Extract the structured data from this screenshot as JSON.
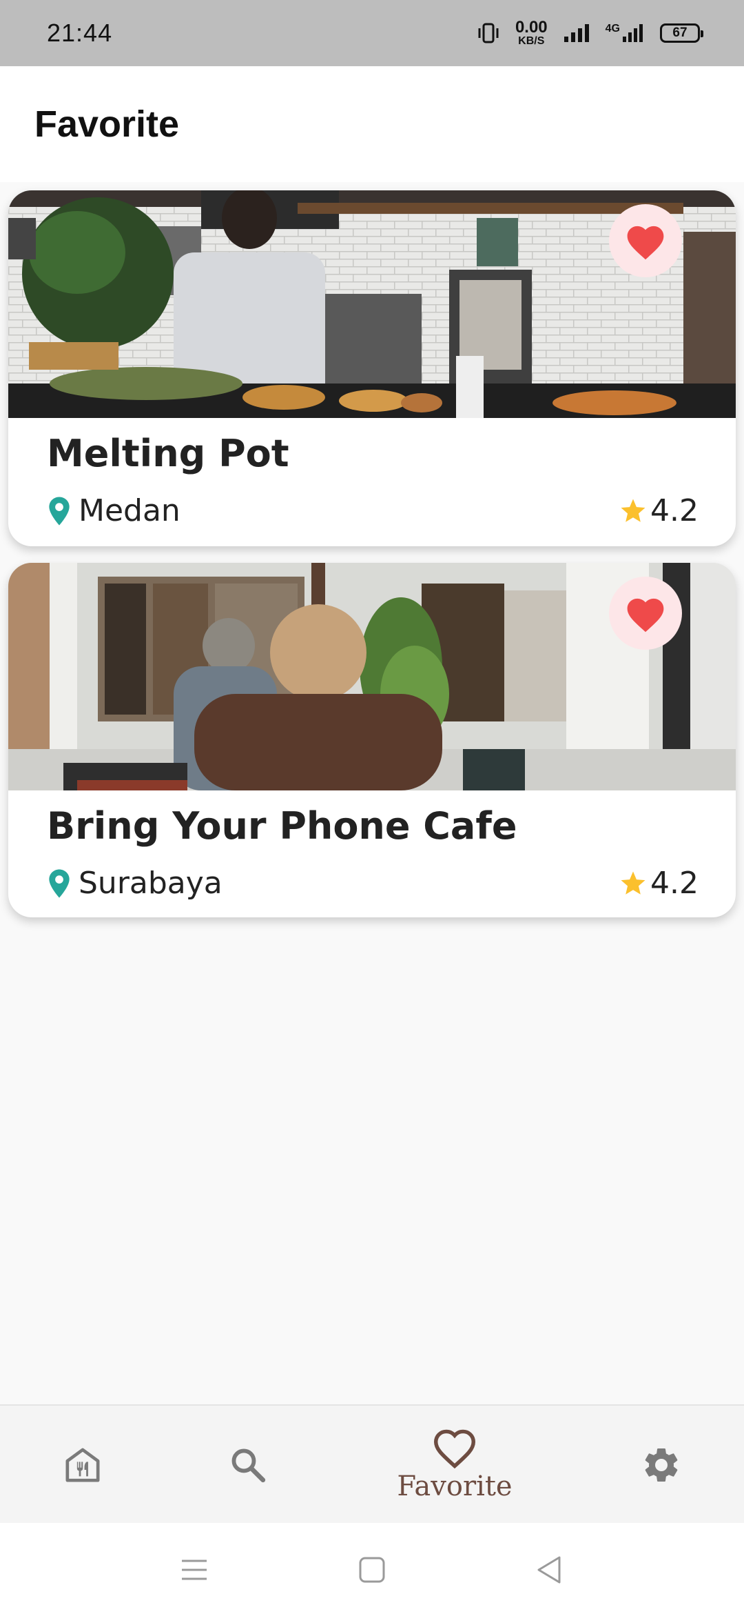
{
  "status_bar": {
    "time": "21:44",
    "net_speed_value": "0.00",
    "net_speed_unit": "KB/S",
    "network_label": "4G",
    "battery": "67"
  },
  "app_bar": {
    "title": "Favorite"
  },
  "favorites": [
    {
      "name": "Melting Pot",
      "city": "Medan",
      "rating": "4.2"
    },
    {
      "name": "Bring Your Phone Cafe",
      "city": "Surabaya",
      "rating": "4.2"
    }
  ],
  "bottom_nav": {
    "items": [
      {
        "icon": "restaurant-icon"
      },
      {
        "icon": "search-icon"
      },
      {
        "icon": "heart-outline-icon",
        "label": "Favorite",
        "active": true
      },
      {
        "icon": "gear-icon"
      }
    ]
  },
  "colors": {
    "accent": "#6d4c41",
    "heart": "#ef4a4a",
    "heart_bg": "#fde6e8",
    "location_pin": "#26a69a",
    "star": "#fbc02d"
  }
}
